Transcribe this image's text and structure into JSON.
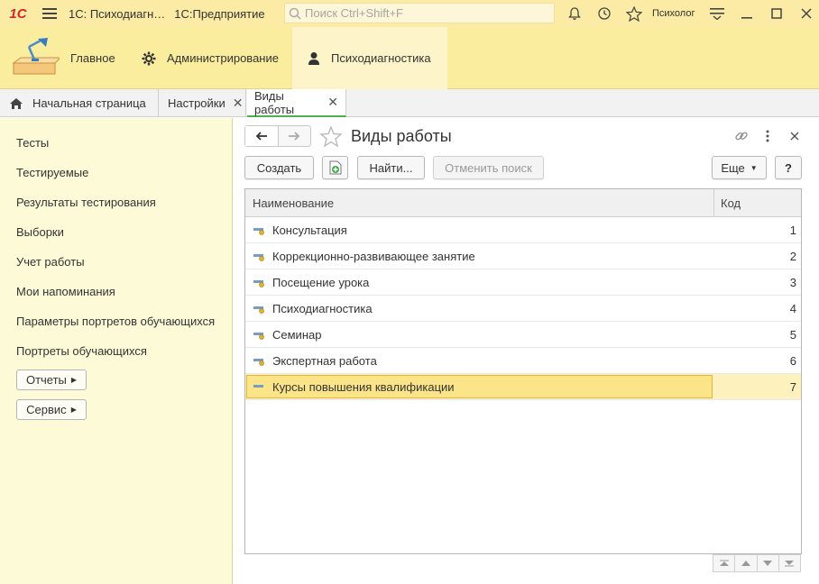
{
  "titlebar": {
    "logo": "1С",
    "app_title": "1С: Психодиагн…",
    "platform": "1С:Предприятие",
    "search_placeholder": "Поиск Ctrl+Shift+F",
    "user": "Психолог"
  },
  "sections": [
    {
      "label": "Главное",
      "icon": "gear-icon"
    },
    {
      "label": "Администрирование",
      "icon": "gear-icon"
    },
    {
      "label": "Психодиагностика",
      "icon": "person-icon"
    }
  ],
  "tabs": [
    {
      "label": "Начальная страница"
    },
    {
      "label": "Настройки"
    },
    {
      "label": "Виды работы"
    }
  ],
  "sidebar": {
    "items": [
      {
        "label": "Тесты"
      },
      {
        "label": "Тестируемые"
      },
      {
        "label": "Результаты тестирования"
      },
      {
        "label": "Выборки"
      },
      {
        "label": "Учет работы"
      },
      {
        "label": "Мои напоминания"
      },
      {
        "label": "Параметры портретов обучающихся"
      },
      {
        "label": "Портреты обучающихся"
      }
    ],
    "reports_label": "Отчеты",
    "service_label": "Сервис"
  },
  "content": {
    "title": "Виды работы",
    "toolbar": {
      "create_label": "Создать",
      "find_label": "Найти...",
      "cancel_search_label": "Отменить поиск",
      "more_label": "Еще",
      "help_label": "?"
    },
    "table": {
      "col_name": "Наименование",
      "col_code": "Код",
      "rows": [
        {
          "name": "Консультация",
          "code": "1"
        },
        {
          "name": "Коррекционно-развивающее занятие",
          "code": "2"
        },
        {
          "name": "Посещение урока",
          "code": "3"
        },
        {
          "name": "Психодиагностика",
          "code": "4"
        },
        {
          "name": "Семинар",
          "code": "5"
        },
        {
          "name": "Экспертная работа",
          "code": "6"
        },
        {
          "name": "Курсы повышения квалификации",
          "code": "7"
        }
      ]
    }
  }
}
